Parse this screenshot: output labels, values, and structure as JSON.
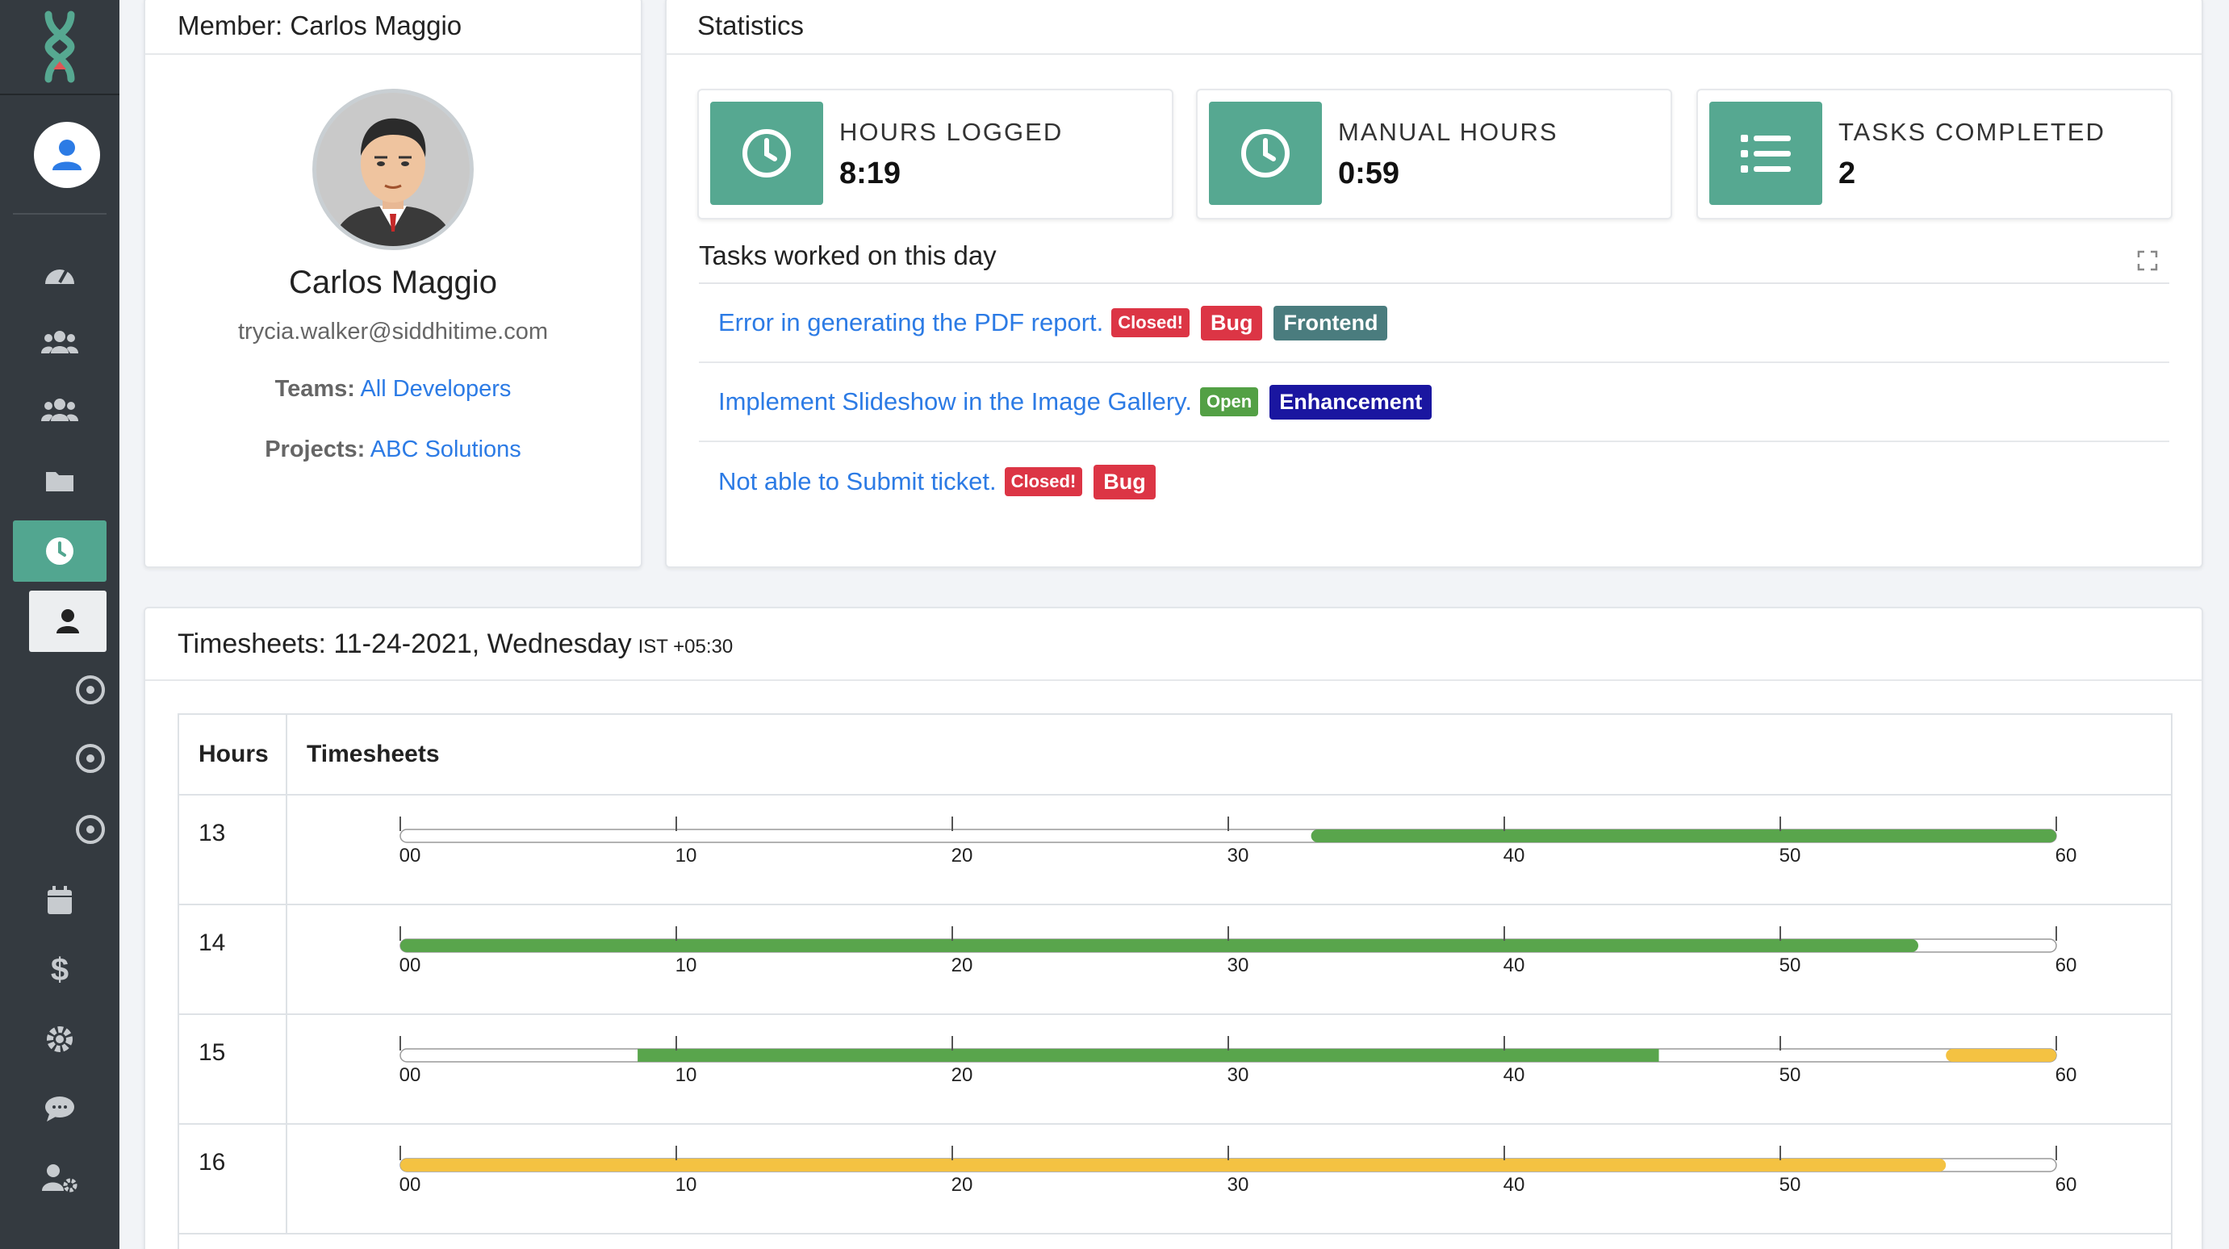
{
  "sidebar": {
    "logo": "hourglass-logo",
    "items": [
      {
        "name": "dashboard",
        "icon": "tachometer-icon"
      },
      {
        "name": "users",
        "icon": "users-icon"
      },
      {
        "name": "teams",
        "icon": "users-group-icon"
      },
      {
        "name": "projects",
        "icon": "folder-icon"
      },
      {
        "name": "timesheets",
        "icon": "clock-icon",
        "active": true
      },
      {
        "name": "calendar",
        "icon": "calendar-icon"
      },
      {
        "name": "billing",
        "icon": "dollar-icon"
      },
      {
        "name": "settings",
        "icon": "gear-icon"
      },
      {
        "name": "chat",
        "icon": "comment-icon"
      },
      {
        "name": "user-settings",
        "icon": "user-cog-icon"
      }
    ]
  },
  "member": {
    "header": "Member: Carlos Maggio",
    "name": "Carlos Maggio",
    "email": "trycia.walker@siddhitime.com",
    "teams_label": "Teams:",
    "teams_value": "All Developers",
    "projects_label": "Projects:",
    "projects_value": "ABC Solutions"
  },
  "stats": {
    "header": "Statistics",
    "boxes": [
      {
        "label": "HOURS LOGGED",
        "value": "8:19",
        "icon": "clock-icon"
      },
      {
        "label": "MANUAL HOURS",
        "value": "0:59",
        "icon": "clock-icon"
      },
      {
        "label": "TASKS COMPLETED",
        "value": "2",
        "icon": "list-icon"
      }
    ],
    "tasks_title": "Tasks worked on this day",
    "tasks": [
      {
        "title": "Error in generating the PDF report.",
        "status": "Closed!",
        "tags": [
          "Bug",
          "Frontend"
        ]
      },
      {
        "title": "Implement Slideshow in the Image Gallery.",
        "status": "Open",
        "tags": [
          "Enhancement"
        ]
      },
      {
        "title": "Not able to Submit ticket.",
        "status": "Closed!",
        "tags": [
          "Bug"
        ]
      }
    ]
  },
  "timesheet": {
    "title": "Timesheets: 11-24-2021, Wednesday",
    "tz": "IST +05:30",
    "col_hours": "Hours",
    "col_timesheets": "Timesheets",
    "ticks": [
      "00",
      "10",
      "20",
      "30",
      "40",
      "50",
      "60"
    ],
    "colors": {
      "tracked": "#59a54c",
      "manual": "#f4c242"
    },
    "rows": [
      {
        "hour": "13",
        "segments": [
          {
            "from": 33,
            "to": 60,
            "type": "tracked"
          }
        ]
      },
      {
        "hour": "14",
        "segments": [
          {
            "from": 0,
            "to": 55,
            "type": "tracked"
          }
        ]
      },
      {
        "hour": "15",
        "segments": [
          {
            "from": 8.6,
            "to": 45.6,
            "type": "tracked"
          },
          {
            "from": 56,
            "to": 60,
            "type": "manual"
          }
        ]
      },
      {
        "hour": "16",
        "segments": [
          {
            "from": 0,
            "to": 56,
            "type": "manual"
          }
        ]
      }
    ]
  }
}
